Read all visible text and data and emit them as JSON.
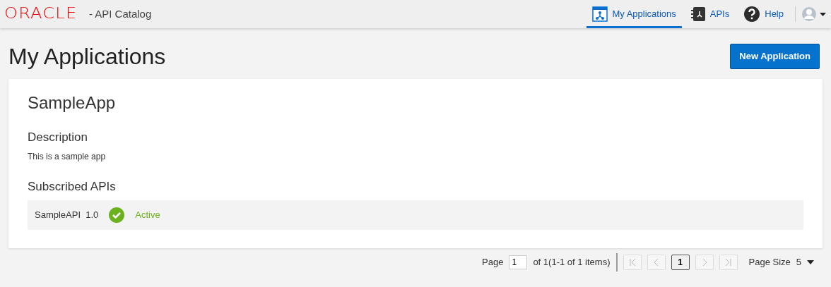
{
  "header": {
    "logo": "ORACLE",
    "title": "- API Catalog",
    "nav": [
      {
        "label": "My Applications",
        "kind": "app",
        "selected": true
      },
      {
        "label": "APIs",
        "kind": "api",
        "selected": false
      },
      {
        "label": "Help",
        "kind": "help",
        "selected": false
      }
    ]
  },
  "page": {
    "title": "My Applications",
    "new_button": "New Application"
  },
  "application": {
    "name": "SampleApp",
    "description_heading": "Description",
    "description": "This is a sample app",
    "subscribed_heading": "Subscribed APIs",
    "subscriptions": [
      {
        "name": "SampleAPI  1.0",
        "status": "Active",
        "kind": "active"
      }
    ]
  },
  "pager": {
    "page_label": "Page",
    "page_value": "1",
    "summary": "of 1(1-1 of 1 items)",
    "nav_buttons": [
      {
        "kind": "first",
        "disabled": true
      },
      {
        "kind": "prev",
        "disabled": true
      },
      {
        "kind": "page",
        "label": "1",
        "selected": true
      },
      {
        "kind": "next",
        "disabled": true
      },
      {
        "kind": "last",
        "disabled": true
      }
    ],
    "page_size_label": "Page Size",
    "page_size": "5"
  }
}
